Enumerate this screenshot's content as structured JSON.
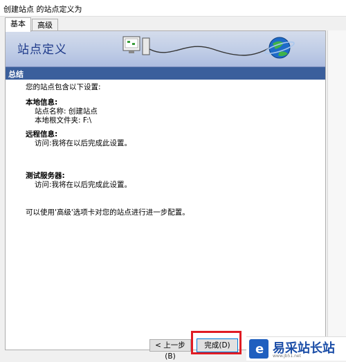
{
  "window": {
    "title": "创建站点 的站点定义为"
  },
  "tabs": [
    {
      "label": "基本"
    },
    {
      "label": "高级"
    }
  ],
  "banner": {
    "title": "站点定义"
  },
  "summary": {
    "header": "总结",
    "intro": "您的站点包含以下设置:",
    "local_heading": "本地信息:",
    "site_name": "站点名称: 创建站点",
    "root_folder": "本地根文件夹: F:\\",
    "remote_heading": "远程信息:",
    "remote_access": "访问:我将在以后完成此设置。",
    "test_heading": "测试服务器:",
    "test_access": "访问:我将在以后完成此设置。",
    "footer": "可以使用'高级'选项卡对您的站点进行进一步配置。"
  },
  "buttons": {
    "back": "< 上一步(B)",
    "finish": "完成(D)"
  },
  "watermark": {
    "text": "易采站长站",
    "url": "www.jb51.net"
  },
  "colors": {
    "accent": "#3b5f9c",
    "highlight": "#e01c24",
    "banner": "#c0cde6"
  }
}
